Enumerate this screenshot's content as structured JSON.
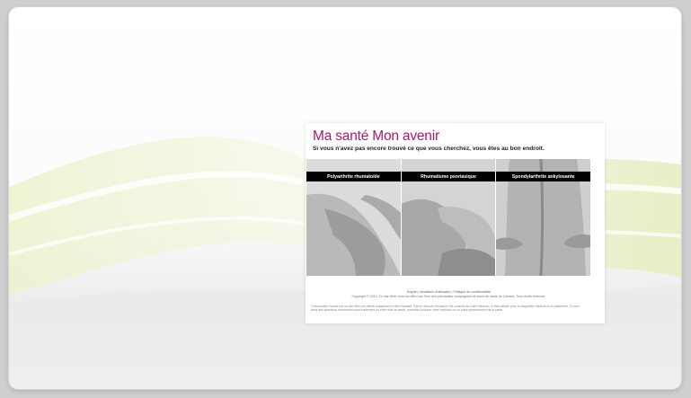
{
  "header": {
    "title": "Ma santé Mon avenir",
    "tagline": "Si vous n'avez pas encore trouvé ce que vous cherchez, vous êtes au bon endroit."
  },
  "cards": [
    {
      "label": "Polyarthrite rhumatoïde",
      "image": "hands-photo"
    },
    {
      "label": "Rhumatisme psoriasique",
      "image": "hand-press-photo"
    },
    {
      "label": "Spondylarthrite ankylosante",
      "image": "back-photo"
    }
  ],
  "footer": {
    "links": [
      "English",
      "Modalités d'utilisation",
      "Politique de confidentialité"
    ],
    "separator": " | ",
    "copyright": "Copyright © 2010. Ce site Web vous est offert par l'une des principales compagnies de soins de santé du Canada. Tous droits réservés.",
    "disclaimer": "L'information fournie par ce site Web est offerte uniquement à titre éducatif. Elle ne doit pas remplacer les conseils de votre médecin, ni être utilisée pour le diagnostic médical ou le traitement. Si vous avez des questions concernant votre traitement ou votre état de santé, consultez toujours votre médecin ou un autre professionnel de la santé."
  },
  "colors": {
    "title": "#b1166c",
    "bar": "#000000",
    "swoosh": "#e6ecbe"
  }
}
